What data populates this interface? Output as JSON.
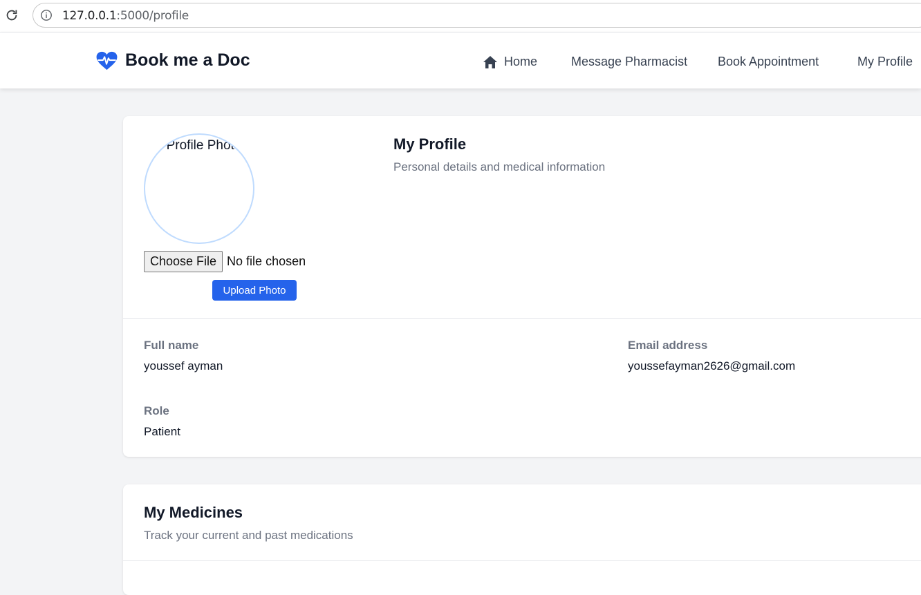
{
  "browser": {
    "url_host": "127.0.0.1",
    "url_path": ":5000/profile"
  },
  "navbar": {
    "brand": "Book me a Doc",
    "links": [
      {
        "label": "Home",
        "icon": "home-icon"
      },
      {
        "label": "Message Pharmacist"
      },
      {
        "label": "Book Appointment"
      },
      {
        "label": "My Profile"
      }
    ]
  },
  "profile": {
    "photo_alt": "Profile Photo",
    "choose_file_label": "Choose File",
    "no_file_text": "No file chosen",
    "upload_label": "Upload Photo",
    "title": "My Profile",
    "subtitle": "Personal details and medical information",
    "fields": {
      "full_name_label": "Full name",
      "full_name_value": "youssef ayman",
      "email_label": "Email address",
      "email_value": "youssefayman2626@gmail.com",
      "role_label": "Role",
      "role_value": "Patient"
    }
  },
  "medicines": {
    "title": "My Medicines",
    "subtitle": "Track your current and past medications"
  },
  "colors": {
    "accent": "#2563eb",
    "background": "#f3f4f6",
    "photo_border": "#bfdbfe"
  }
}
